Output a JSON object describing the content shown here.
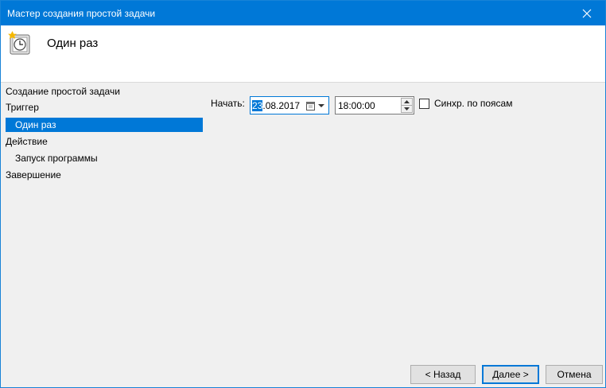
{
  "window": {
    "title": "Мастер создания простой задачи"
  },
  "header": {
    "title": "Один раз",
    "icon": "task-scheduler-icon"
  },
  "sidebar": {
    "items": [
      {
        "label": "Создание простой задачи"
      },
      {
        "label": "Триггер"
      },
      {
        "label": "Один раз"
      },
      {
        "label": "Действие"
      },
      {
        "label": "Запуск программы"
      },
      {
        "label": "Завершение"
      }
    ]
  },
  "form": {
    "start_label": "Начать:",
    "date_selected": "23",
    "date_rest": ".08.2017",
    "time_value": "18:00:00",
    "sync_label": "Синхр. по поясам"
  },
  "buttons": {
    "back": "< Назад",
    "next": "Далее >",
    "cancel": "Отмена"
  },
  "colors": {
    "accent": "#0078d7"
  }
}
